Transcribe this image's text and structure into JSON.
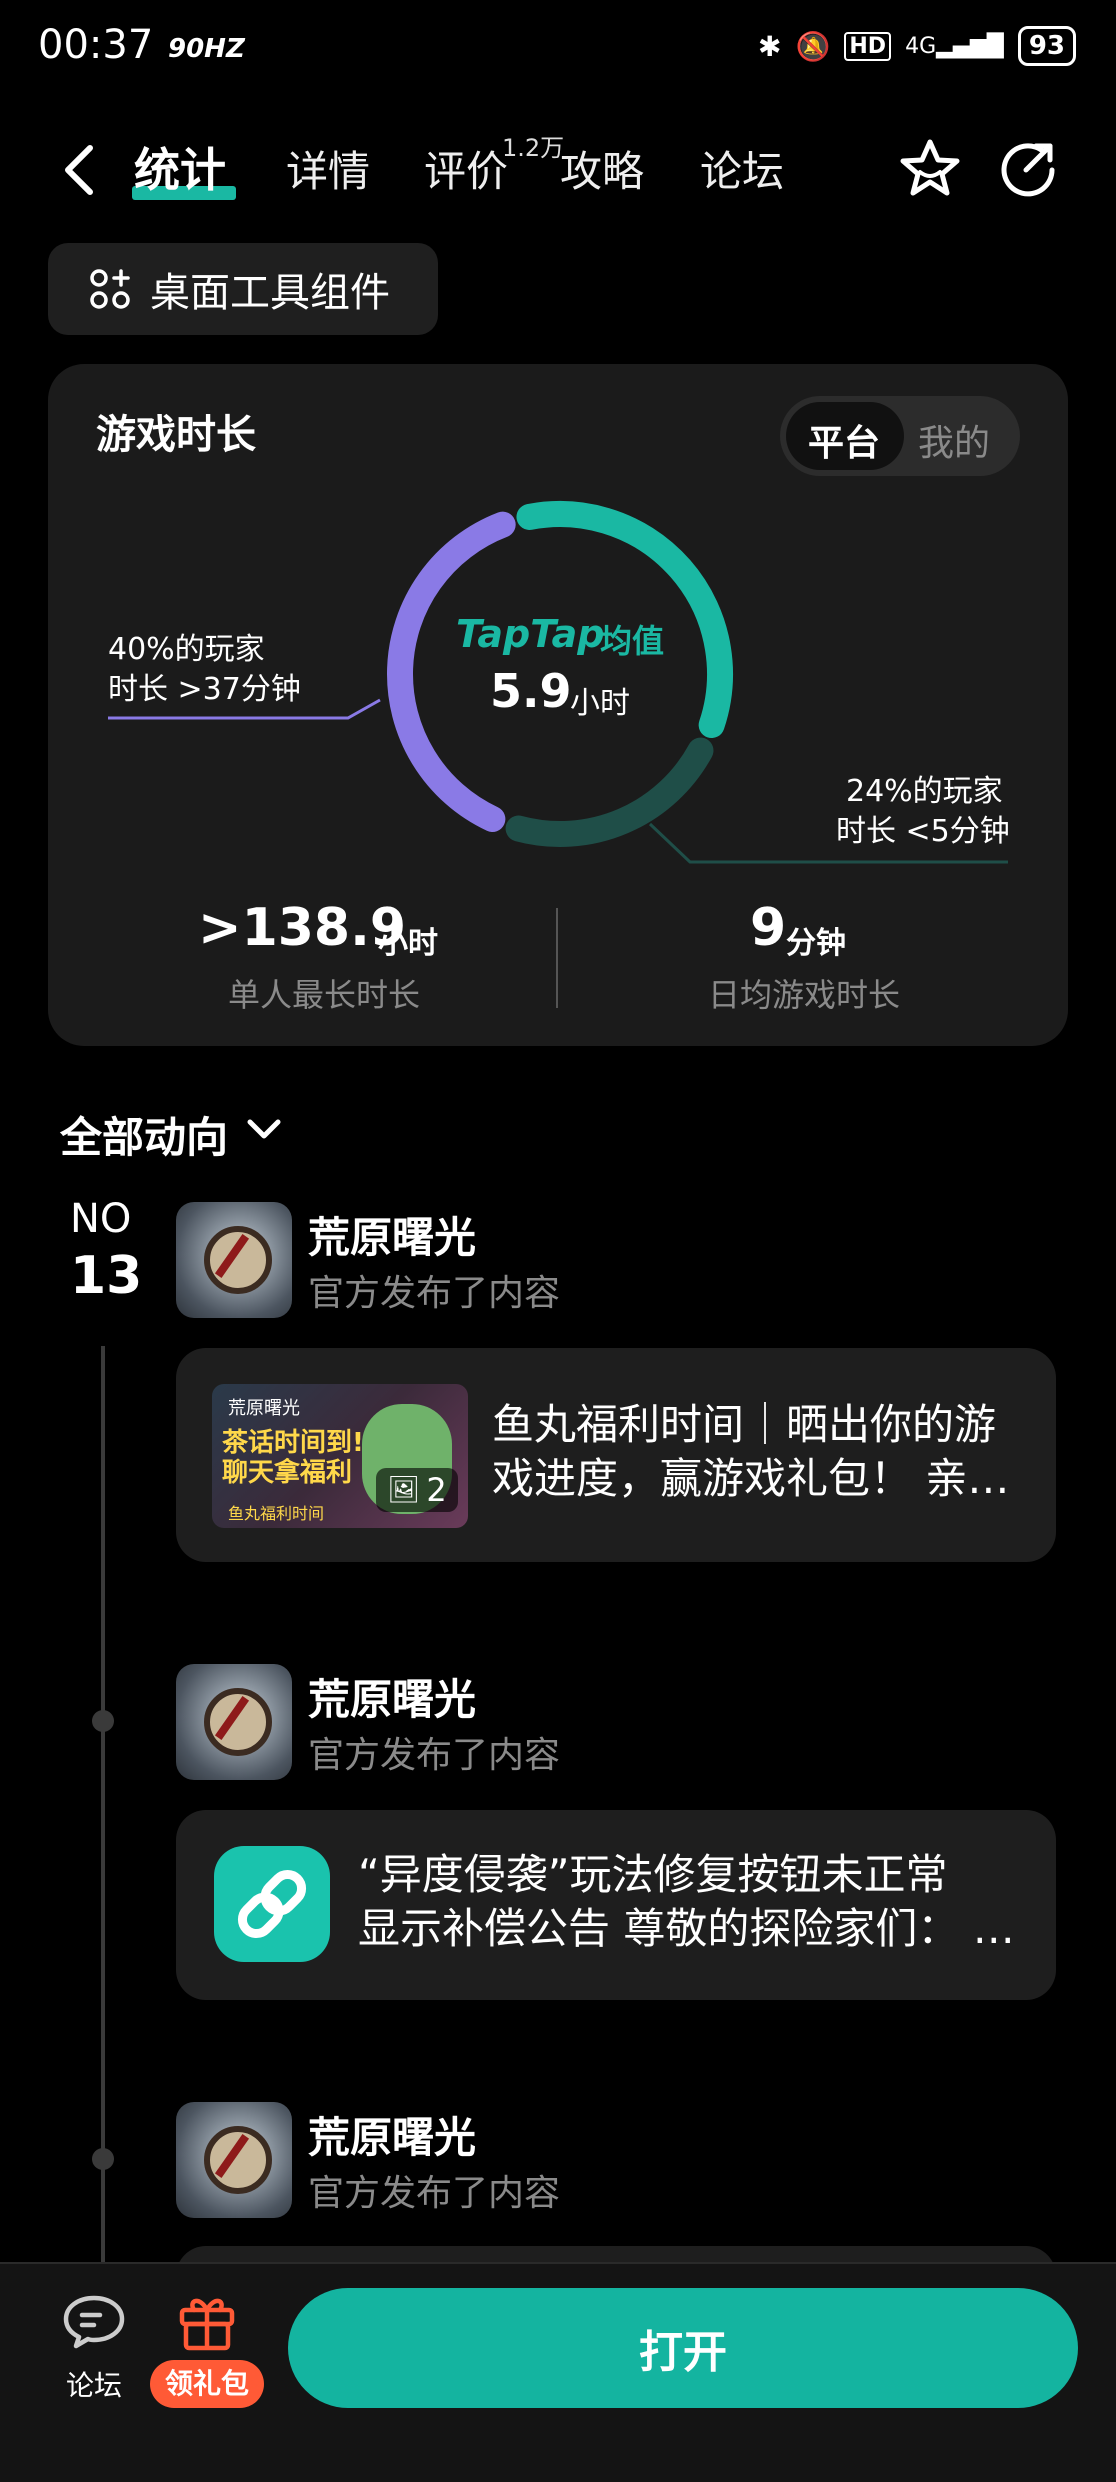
{
  "status_bar": {
    "time": "00:37",
    "refresh": "90HZ",
    "network": "4G",
    "hd": "HD",
    "battery": "93"
  },
  "nav": {
    "tabs": [
      {
        "label": "统计",
        "active": true
      },
      {
        "label": "详情"
      },
      {
        "label": "评价"
      },
      {
        "label": "攻略"
      },
      {
        "label": "论坛"
      }
    ],
    "review_count": "1.2万"
  },
  "widget_button": "桌面工具组件",
  "playtime_card": {
    "title": "游戏时长",
    "toggle": {
      "on": "平台",
      "off": "我的"
    },
    "donut": {
      "segments": [
        {
          "name": "long",
          "fraction": 0.4,
          "color": "#8a7ae6"
        },
        {
          "name": "mid",
          "fraction": 0.36,
          "color": "#1ab8a3"
        },
        {
          "name": "short",
          "fraction": 0.24,
          "color": "#1f4e48"
        }
      ]
    },
    "center_logo": "TapTap",
    "center_logo_sub": "均值",
    "center_value": "5.9",
    "center_unit": "小时",
    "left_label_line1": "40%的玩家",
    "left_label_line2": "时长 >37分钟",
    "right_label_line1": "24%的玩家",
    "right_label_line2": "时长 <5分钟",
    "stat_max_value": ">138.9",
    "stat_max_unit": "小时",
    "stat_max_caption": "单人最长时长",
    "stat_daily_value": "9",
    "stat_daily_unit": "分钟",
    "stat_daily_caption": "日均游戏时长"
  },
  "feed": {
    "filter": "全部动向",
    "rank_label": "NO",
    "rank_number": "13",
    "posts": [
      {
        "author": "荒原曙光",
        "sub": "官方发布了内容",
        "text_line1": "鱼丸福利时间｜晒出你的游",
        "text_line2": "戏进度，赢游戏礼包！ 亲…",
        "image_count": "2",
        "thumb_title": "荒原曙光",
        "thumb_text_line1": "茶话时间到!",
        "thumb_text_line2": "聊天拿福利",
        "thumb_tag": "鱼丸福利时间"
      },
      {
        "author": "荒原曙光",
        "sub": "官方发布了内容",
        "text_line1": "“异度侵袭”玩法修复按钮未正常",
        "text_line2": "显示补偿公告 尊敬的探险家们：  …"
      },
      {
        "author": "荒原曙光",
        "sub": "官方发布了内容"
      }
    ]
  },
  "bottom_bar": {
    "forum": "论坛",
    "gift": "领礼包",
    "open": "打开"
  },
  "colors": {
    "accent": "#1ab8a3",
    "purple": "#8a7ae6",
    "gift": "#ff5a36"
  }
}
